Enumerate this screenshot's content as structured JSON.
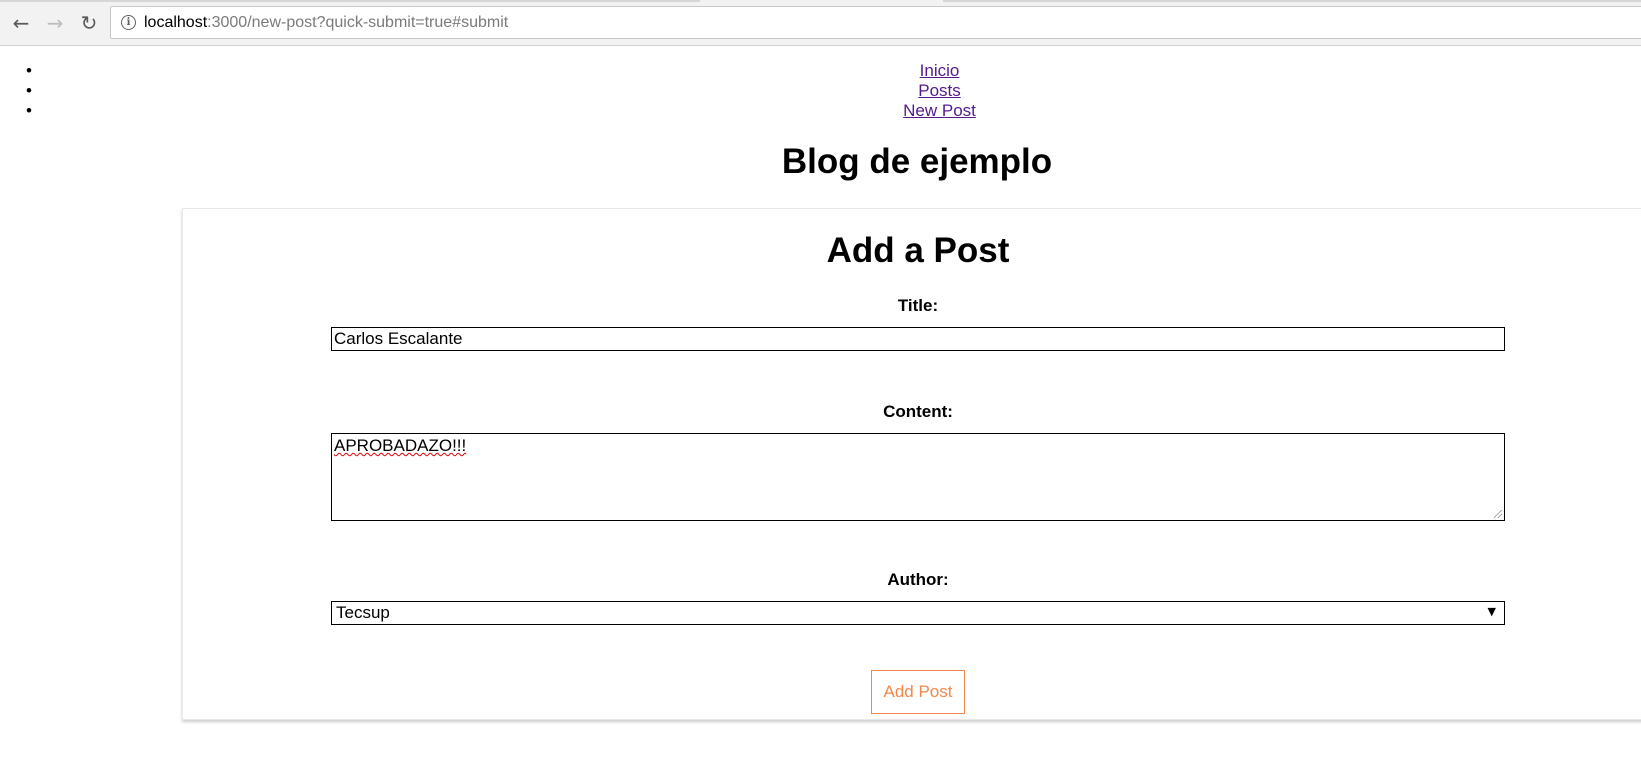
{
  "browser": {
    "url_host": "localhost",
    "url_rest": ":3000/new-post?quick-submit=true#submit",
    "back_icon": "back-arrow-icon",
    "forward_icon": "forward-arrow-icon",
    "reload_icon": "reload-icon",
    "info_icon": "info-icon"
  },
  "nav": {
    "items": [
      {
        "label": "Inicio"
      },
      {
        "label": "Posts"
      },
      {
        "label": "New Post"
      }
    ],
    "bullet": "•"
  },
  "blog_title": "Blog de ejemplo",
  "form": {
    "heading": "Add a Post",
    "title_label": "Title:",
    "title_value": "Carlos Escalante",
    "content_label": "Content:",
    "content_value": "APROBADAZO!!!",
    "author_label": "Author:",
    "author_selected": "Tecsup",
    "submit_label": "Add Post"
  },
  "colors": {
    "link_visited": "#551a8b",
    "button_accent": "#f0884a"
  }
}
